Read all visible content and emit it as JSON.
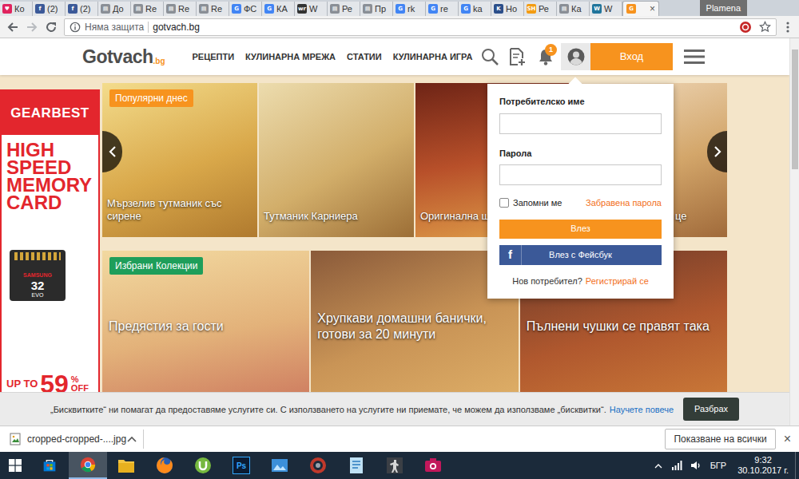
{
  "browser": {
    "tabs": [
      {
        "favicon": "♥",
        "label": "Ко",
        "color": "#e0245e",
        "selected": false
      },
      {
        "favicon": "f",
        "label": "(2)",
        "color": "#3b5998",
        "selected": false
      },
      {
        "favicon": "f",
        "label": "(2)",
        "color": "#3b5998",
        "selected": false
      },
      {
        "favicon": "▤",
        "label": "До",
        "color": "#8a8f96",
        "selected": false
      },
      {
        "favicon": "▤",
        "label": "Re",
        "color": "#8a8f96",
        "selected": false
      },
      {
        "favicon": "▤",
        "label": "Re",
        "color": "#8a8f96",
        "selected": false
      },
      {
        "favicon": "▤",
        "label": "Re",
        "color": "#8a8f96",
        "selected": false
      },
      {
        "favicon": "G",
        "label": "ФС",
        "color": "#4285f4",
        "selected": false
      },
      {
        "favicon": "G",
        "label": "КА",
        "color": "#4285f4",
        "selected": false
      },
      {
        "favicon": "wr",
        "label": "W",
        "color": "#333333",
        "selected": false
      },
      {
        "favicon": "▤",
        "label": "Ре",
        "color": "#8a8f96",
        "selected": false
      },
      {
        "favicon": "▤",
        "label": "Пр",
        "color": "#8a8f96",
        "selected": false
      },
      {
        "favicon": "G",
        "label": "rk",
        "color": "#4285f4",
        "selected": false
      },
      {
        "favicon": "G",
        "label": "re",
        "color": "#4285f4",
        "selected": false
      },
      {
        "favicon": "G",
        "label": "ka",
        "color": "#4285f4",
        "selected": false
      },
      {
        "favicon": "K",
        "label": "Но",
        "color": "#2c4f8a",
        "selected": false
      },
      {
        "favicon": "SH",
        "label": "Ре",
        "color": "#f39c12",
        "selected": false
      },
      {
        "favicon": "▤",
        "label": "Ка",
        "color": "#8a8f96",
        "selected": false
      },
      {
        "favicon": "W",
        "label": "W",
        "color": "#21759b",
        "selected": false
      },
      {
        "favicon": "G",
        "close": "×",
        "color": "#f7931e",
        "selected": true
      }
    ],
    "user": "Plamena",
    "address": {
      "security": "Няма защита",
      "url": "gotvach.bg"
    }
  },
  "site": {
    "logo": {
      "text": "Gotvach",
      "suffix": ".bg"
    },
    "nav": [
      "РЕЦЕПТИ",
      "КУЛИНАРНА МРЕЖА",
      "СТАТИИ",
      "КУЛИНАРНА ИГРА"
    ],
    "notifications": "1",
    "login_button": "Вход"
  },
  "ad": {
    "brand": "GEARBEST",
    "headline": [
      "HIGH",
      "SPEED",
      "MEMORY",
      "CARD"
    ],
    "card": {
      "brand": "SAMSUNG",
      "size": "32",
      "model": "EVO"
    },
    "offer": {
      "prefix": "UP TO",
      "value": "59",
      "percent": "%",
      "suffix": "OFF"
    }
  },
  "carousel": {
    "badge": "Популярни днес",
    "items": [
      {
        "caption": "Мързелив тутманик със сирене"
      },
      {
        "caption": "Тутманик Карниера"
      },
      {
        "caption": "Оригинална шк"
      },
      {
        "caption": "це"
      }
    ]
  },
  "collections": {
    "badge": "Избрани Колекции",
    "items": [
      {
        "caption": "Предястия за гости"
      },
      {
        "caption": "Хрупкави домашни банички, готови за 20 минути"
      },
      {
        "caption": "Пълнени чушки се правят така"
      }
    ]
  },
  "login": {
    "open": true,
    "username_label": "Потребителско име",
    "password_label": "Парола",
    "remember": {
      "label": "Запомни ме",
      "checked": false
    },
    "forgot": "Забравена парола",
    "submit": "Влез",
    "facebook": {
      "icon": "f",
      "label": "Влез с Фейсбук"
    },
    "register_prompt": "Нов потребител?",
    "register_link": "Регистрирай се"
  },
  "cookies": {
    "text": "„Бисквитките“ ни помагат да предоставяме услугите си. С използването на услугите ни приемате, че можем да използваме „бисквитки“.",
    "link": "Научете повече",
    "button": "Разбрах"
  },
  "downloads": {
    "file": "cropped-cropped-....jpg",
    "show_all": "Показване на всички",
    "close": "×"
  },
  "taskbar": {
    "apps": [
      {
        "kind": "store",
        "selected": false
      },
      {
        "kind": "chrome",
        "selected": true
      },
      {
        "kind": "explorer",
        "selected": false
      },
      {
        "kind": "firefox",
        "selected": false
      },
      {
        "kind": "utorrent",
        "selected": false
      },
      {
        "kind": "photoshop",
        "label": "Ps",
        "selected": false
      },
      {
        "kind": "photos",
        "selected": false
      },
      {
        "kind": "ring",
        "selected": false
      },
      {
        "kind": "notepad",
        "selected": false
      },
      {
        "kind": "cs",
        "selected": false
      },
      {
        "kind": "camera",
        "selected": false
      }
    ],
    "language": "БГР",
    "time": "9:32",
    "date": "30.10.2017 г."
  }
}
